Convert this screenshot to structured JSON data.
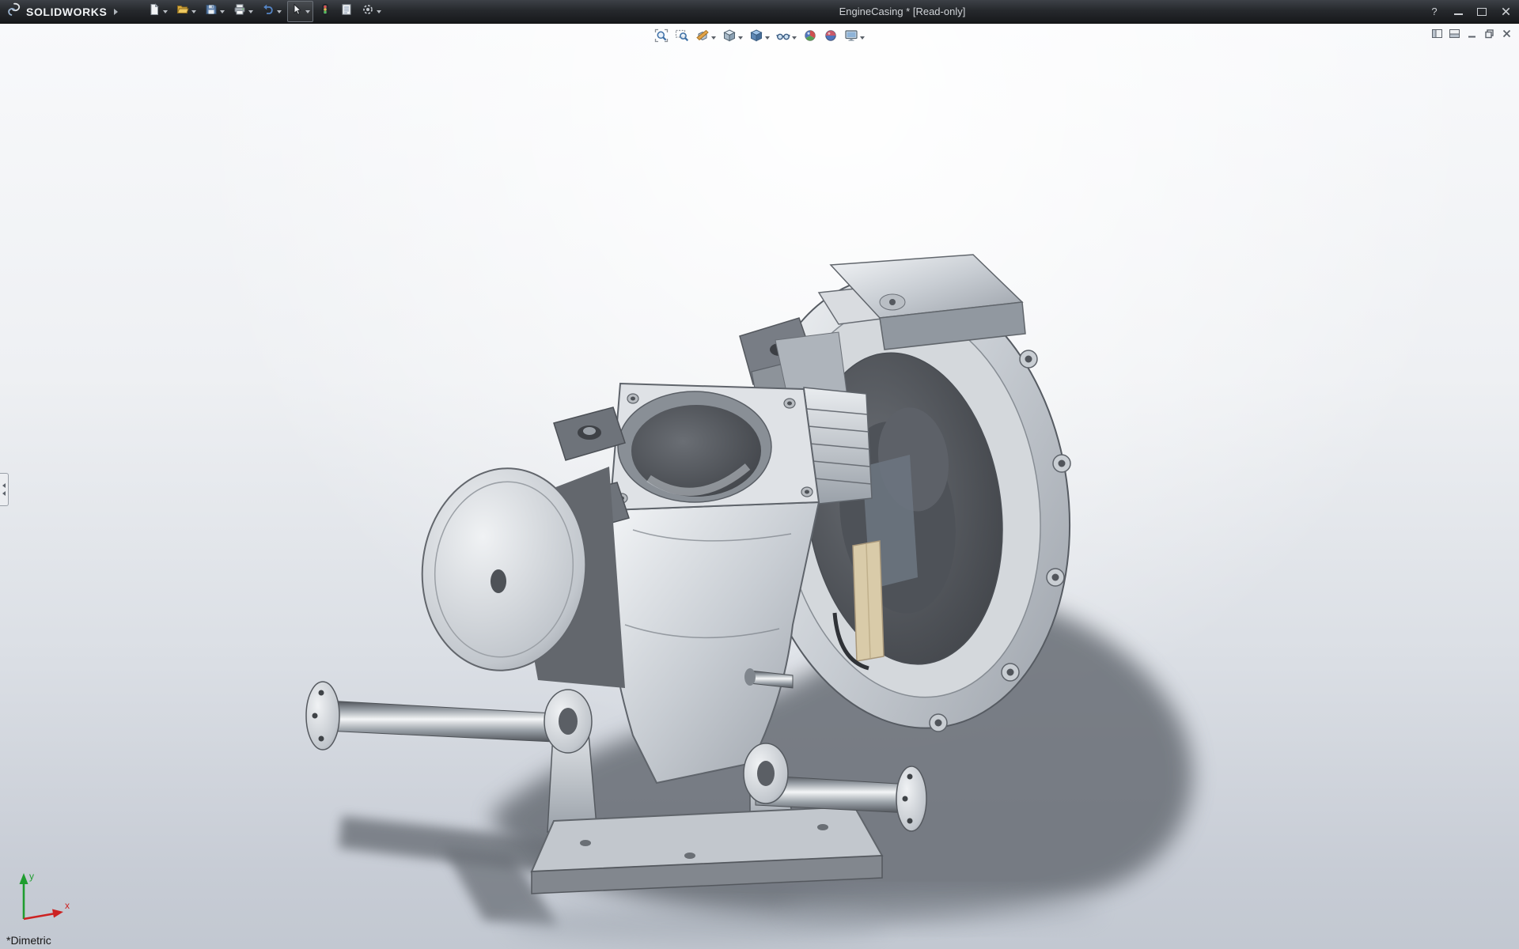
{
  "titlebar": {
    "brand": "SOLIDWORKS",
    "title": "EngineCasing * [Read-only]",
    "help_label": "?",
    "tools": [
      {
        "name": "new-document",
        "dropdown": true
      },
      {
        "name": "open",
        "dropdown": true
      },
      {
        "name": "save",
        "dropdown": true
      },
      {
        "name": "print",
        "dropdown": true
      },
      {
        "name": "undo",
        "dropdown": true
      },
      {
        "name": "select",
        "dropdown": true,
        "pressed": true
      },
      {
        "name": "rebuild",
        "dropdown": false
      },
      {
        "name": "file-properties",
        "dropdown": false
      },
      {
        "name": "options",
        "dropdown": true
      }
    ],
    "window_controls": [
      "help",
      "minimize",
      "maximize",
      "close"
    ]
  },
  "headsup_toolbar": {
    "items": [
      {
        "name": "zoom-to-fit",
        "dropdown": false
      },
      {
        "name": "zoom-to-area",
        "dropdown": false
      },
      {
        "name": "section-view",
        "dropdown": true
      },
      {
        "name": "view-orientation",
        "dropdown": true
      },
      {
        "name": "display-style",
        "dropdown": true
      },
      {
        "name": "hide-show-items",
        "dropdown": true
      },
      {
        "name": "edit-appearance",
        "dropdown": false
      },
      {
        "name": "apply-scene",
        "dropdown": false
      },
      {
        "name": "view-settings",
        "dropdown": true
      }
    ]
  },
  "document_controls": {
    "items": [
      "pane-split-vertical",
      "pane-split-horizontal",
      "minimize",
      "restore",
      "close"
    ]
  },
  "viewport": {
    "view_label": "*Dimetric",
    "triad": {
      "x_label": "x",
      "y_label": "y"
    }
  },
  "colors": {
    "titlebar_bg_top": "#3d4147",
    "titlebar_bg_bottom": "#17191b",
    "viewport_gradient_top": "#f8f9fb",
    "viewport_gradient_bottom": "#c2c8d1",
    "axis_x": "#cc2222",
    "axis_y": "#1f9d2f",
    "shadow": "#686d74",
    "accent_blue": "#3c6ea5"
  }
}
